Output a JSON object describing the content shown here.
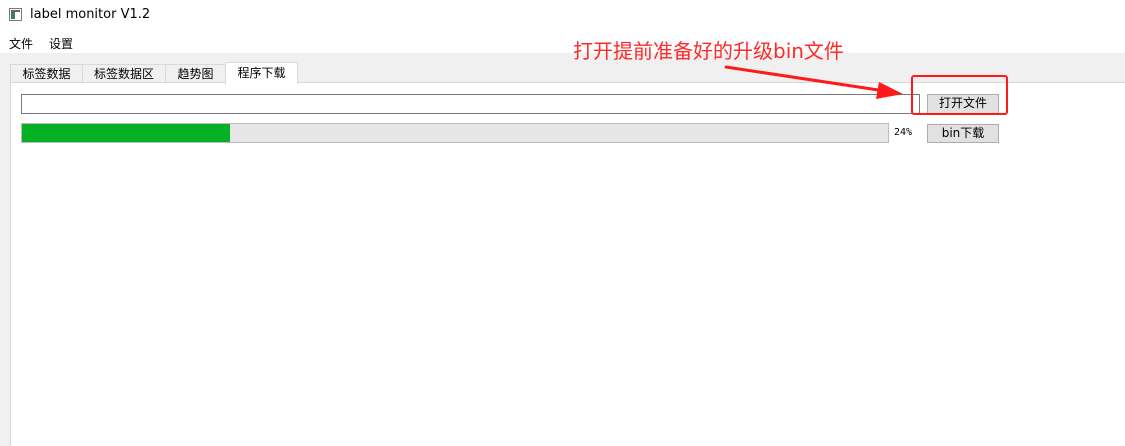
{
  "window": {
    "title": "label monitor V1.2",
    "icon": "app-icon"
  },
  "menu": {
    "items": [
      "文件",
      "设置"
    ]
  },
  "tabs": [
    {
      "label": "标签数据",
      "active": false
    },
    {
      "label": "标签数据区",
      "active": false
    },
    {
      "label": "趋势图",
      "active": false
    },
    {
      "label": "程序下载",
      "active": true
    }
  ],
  "download": {
    "file_path_value": "",
    "open_file_label": "打开文件",
    "bin_download_label": "bin下载",
    "progress_percent": 24,
    "progress_text": "24%"
  },
  "annotation": {
    "text": "打开提前准备好的升级bin文件",
    "color": "#ff2a2a"
  },
  "colors": {
    "progress_fill": "#06b025",
    "annotation": "#ff1a1a"
  }
}
